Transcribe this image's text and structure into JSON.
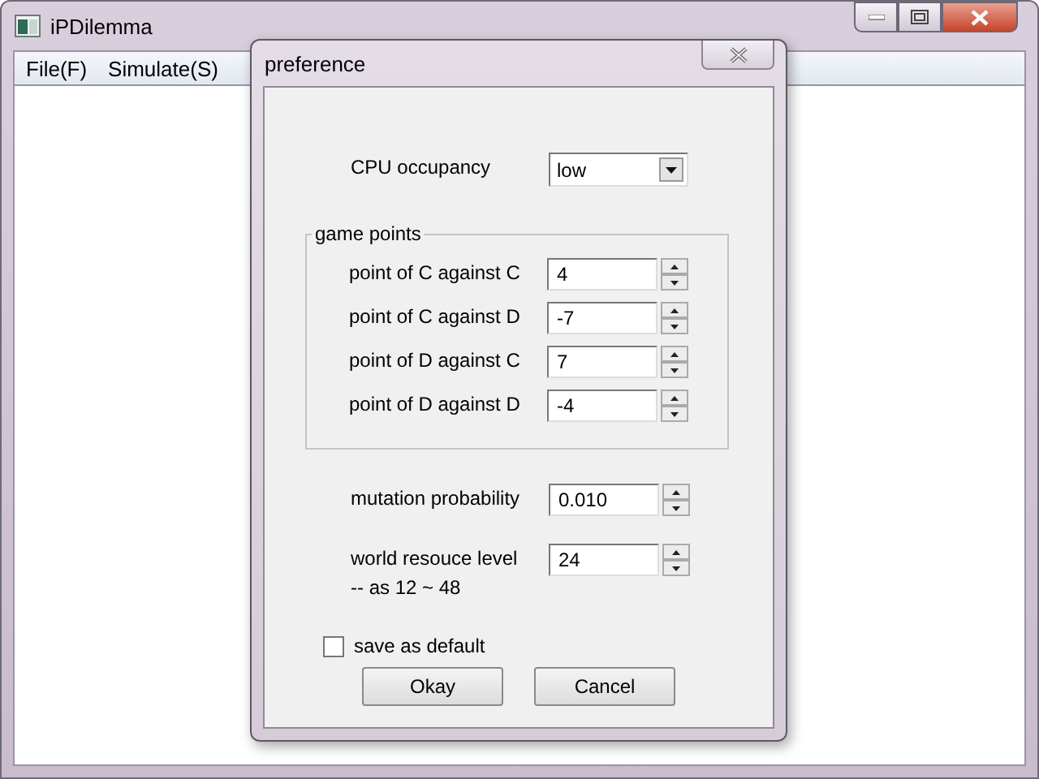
{
  "window": {
    "title": "iPDilemma"
  },
  "menu": [
    {
      "label": "File(F)"
    },
    {
      "label": "Simulate(S)"
    }
  ],
  "dialog": {
    "title": "preference",
    "cpu": {
      "label": "CPU occupancy",
      "value": "low"
    },
    "group": {
      "title": "game points",
      "fields": [
        {
          "label": "point of C against C",
          "value": "4"
        },
        {
          "label": "point of C against D",
          "value": "-7"
        },
        {
          "label": "point of D against C",
          "value": "7"
        },
        {
          "label": "point of D against D",
          "value": "-4"
        }
      ]
    },
    "fields": [
      {
        "label": "mutation probability",
        "value": "0.010"
      },
      {
        "label": "world resouce level",
        "note": "-- as 12 ~ 48",
        "value": "24"
      }
    ],
    "save_default": {
      "label": "save as default",
      "checked": false
    },
    "buttons": [
      "Okay",
      "Cancel"
    ]
  }
}
